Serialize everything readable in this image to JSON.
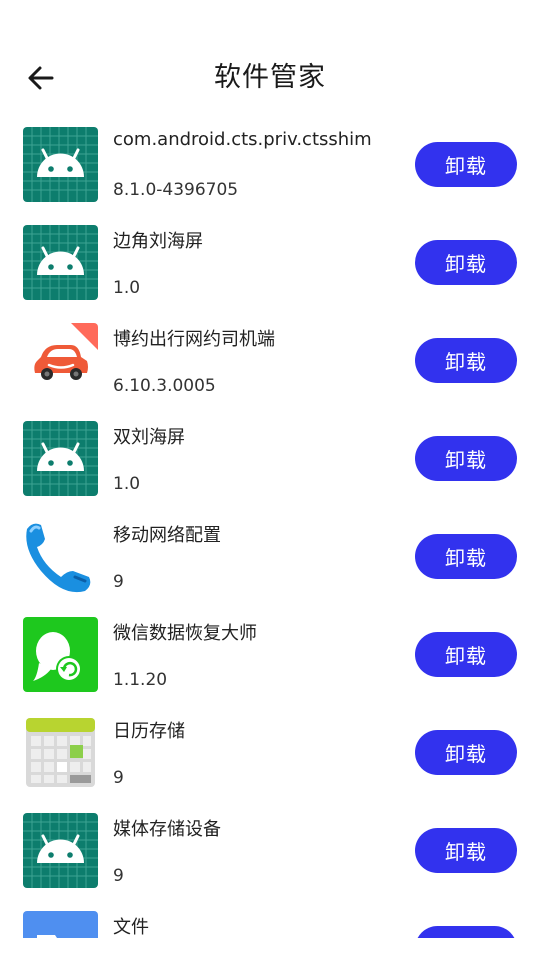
{
  "header": {
    "title": "软件管家",
    "back_icon": "arrow-left-icon"
  },
  "colors": {
    "accent": "#3232ee",
    "android_bg": "#0d7d6d"
  },
  "apps": [
    {
      "name": "com.android.cts.priv.ctsshim",
      "version": "8.1.0-4396705",
      "icon": "android-robot-icon",
      "button": "卸载"
    },
    {
      "name": "边角刘海屏",
      "version": "1.0",
      "icon": "android-robot-icon",
      "button": "卸载"
    },
    {
      "name": "博约出行网约司机端",
      "version": "6.10.3.0005",
      "icon": "red-car-icon",
      "button": "卸载"
    },
    {
      "name": "双刘海屏",
      "version": "1.0",
      "icon": "android-robot-icon",
      "button": "卸载"
    },
    {
      "name": "移动网络配置",
      "version": "9",
      "icon": "phone-handset-icon",
      "button": "卸载"
    },
    {
      "name": "微信数据恢复大师",
      "version": "1.1.20",
      "icon": "chat-restore-icon",
      "button": "卸载"
    },
    {
      "name": "日历存储",
      "version": "9",
      "icon": "calendar-grid-icon",
      "button": "卸载"
    },
    {
      "name": "媒体存储设备",
      "version": "9",
      "icon": "android-robot-icon",
      "button": "卸载"
    },
    {
      "name": "文件",
      "version": "",
      "icon": "folder-icon",
      "button": "卸载"
    }
  ]
}
